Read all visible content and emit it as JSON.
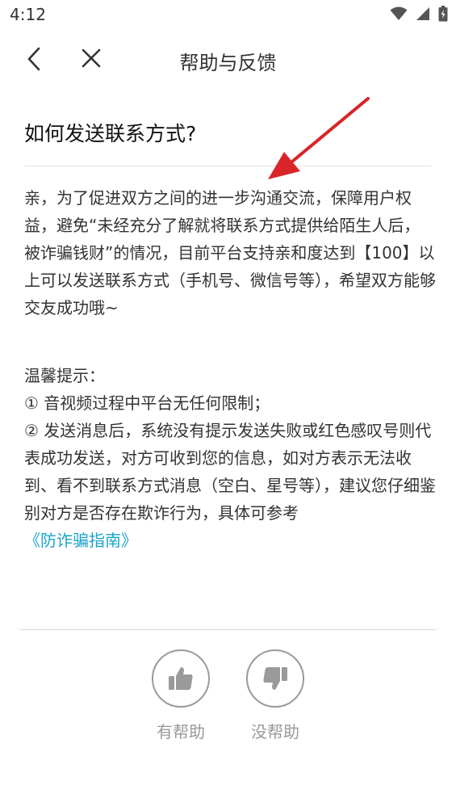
{
  "status_bar": {
    "time": "4:12"
  },
  "nav": {
    "title": "帮助与反馈"
  },
  "question": {
    "title": "如何发送联系方式?"
  },
  "content": {
    "paragraph1": "亲，为了促进双方之间的进一步沟通交流，保障用户权益，避免“未经充分了解就将联系方式提供给陌生人后，被诈骗钱财”的情况，目前平台支持亲和度达到【100】以上可以发送联系方式（手机号、微信号等），希望双方能够交友成功哦~",
    "tips_heading": "温馨提示：",
    "tip1": "① 音视频过程中平台无任何限制；",
    "tip2": "② 发送消息后，系统没有提示发送失败或红色感叹号则代表成功发送，对方可收到您的信息，如对方表示无法收到、看不到联系方式消息（空白、星号等），建议您仔细鉴别对方是否存在欺诈行为，具体可参考",
    "guide_link": "《防诈骗指南》"
  },
  "feedback": {
    "helpful_label": "有帮助",
    "not_helpful_label": "没帮助"
  },
  "colors": {
    "link": "#1aa3c9",
    "annotation_arrow": "#d9252a",
    "icon_gray": "#9a9a9a"
  }
}
